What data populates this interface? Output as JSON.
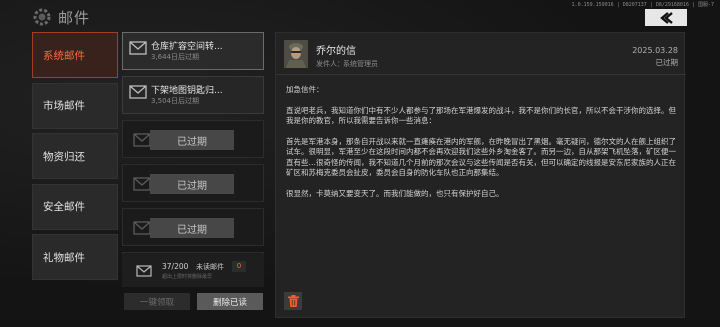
{
  "header": {
    "title": "邮件",
    "version": "1.0.159.159016 | D8207137 | D8/29168016 | 国服-7"
  },
  "nav": {
    "items": [
      {
        "label": "系统邮件",
        "active": true
      },
      {
        "label": "市场邮件",
        "active": false
      },
      {
        "label": "物资归还",
        "active": false
      },
      {
        "label": "安全邮件",
        "active": false
      },
      {
        "label": "礼物邮件",
        "active": false
      }
    ]
  },
  "mail_list": {
    "items": [
      {
        "title": "仓库扩容空间转...",
        "sub": "3,644日后过期"
      },
      {
        "title": "下架地图钥匙归...",
        "sub": "3,504日后过期"
      }
    ],
    "expired_label": "已过期",
    "footer": {
      "count": "37/200",
      "unread_label": "未读邮件",
      "unread_count": "0",
      "note": "超出上限时将删除最早"
    }
  },
  "buttons": {
    "claim_all": "一键领取",
    "delete_read": "删除已读"
  },
  "detail": {
    "title": "乔尔的信",
    "sender_label": "发件人：",
    "sender": "系统管理员",
    "date": "2025.03.28",
    "status": "已过期",
    "paragraphs": [
      "加急信件：",
      "直说吧老兵，我知道你们中有不少人都参与了那场在军港爆发的战斗，我不是你们的长官，所以不会干涉你的选择。但我是你的教官，所以我需要告诉你一些消息：",
      "首先是军港本身，那条自开战以来就一直瘫痪在港内的军舰，在昨晚冒出了黑烟。毫无疑问，德尔文的人在舰上组织了试车。很明显，军港至少在这段时间内都不会再欢迎我们这些外乡淘金客了。而另一边，自从那架飞机坠落，矿区便一直有些…很奇怪的传闻，我不知道几个月前的那次会议与这些传闻是否有关，但可以确定的线报是安东尼家族的人正在矿区和苏梅克委员会扯皮，委员会自身的防化车队也正向那集结。",
      "很显然，卡莫纳又要变天了。而我们能做的，也只有保护好自己。"
    ]
  },
  "colors": {
    "accent": "#ff6a3a",
    "active_nav_bg": "#3a221c",
    "panel_bg": "#232323"
  },
  "icons": {
    "logo": "gear-icon",
    "back": "chevron-left-icon",
    "mail": "envelope-icon",
    "delete": "trash-icon"
  }
}
